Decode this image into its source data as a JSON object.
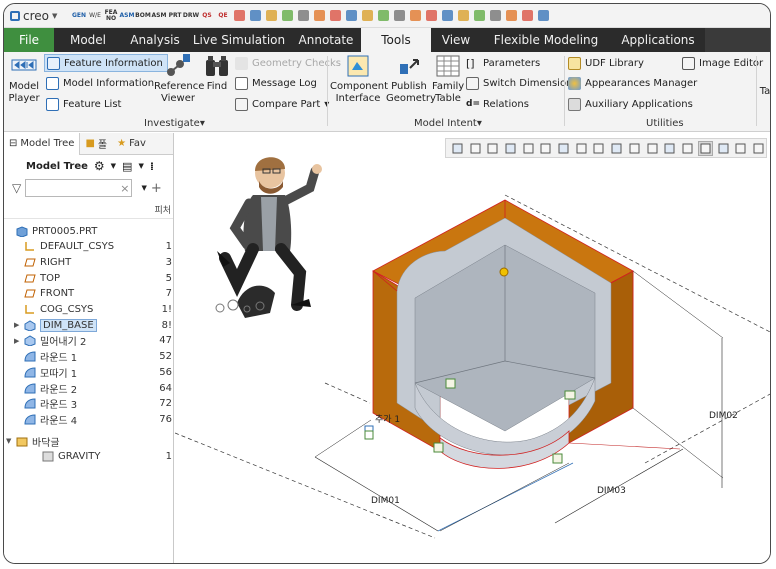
{
  "app": {
    "logo_text": "creo",
    "logo_drop": "▼"
  },
  "quick_access": [
    {
      "name": "gen",
      "text": "GEN",
      "cls": "gen"
    },
    {
      "name": "bre",
      "text": "W/E",
      "cls": ""
    },
    {
      "name": "fea",
      "text": "FEA NO",
      "cls": "blk"
    },
    {
      "name": "asm-green",
      "text": "ASM",
      "cls": "gen"
    },
    {
      "name": "bom",
      "text": "BOM",
      "cls": "blk"
    },
    {
      "name": "asm",
      "text": "ASM",
      "cls": "blk"
    },
    {
      "name": "prt",
      "text": "PRT",
      "cls": "blk"
    },
    {
      "name": "drw",
      "text": "DRW",
      "cls": "blk"
    },
    {
      "name": "qs",
      "text": "QS",
      "cls": "red"
    },
    {
      "name": "qe",
      "text": "QE",
      "cls": "red"
    }
  ],
  "tabs": {
    "file": "File",
    "model": "Model",
    "analysis": "Analysis",
    "live_simulation": "Live Simulation",
    "annotate": "Annotate",
    "tools": "Tools",
    "view": "View",
    "flexible_modeling": "Flexible Modeling",
    "applications": "Applications"
  },
  "ribbon": {
    "model_player": "Model Player",
    "feature_information": "Feature Information",
    "model_information": "Model Information",
    "feature_list": "Feature List",
    "reference_viewer": "Reference Viewer",
    "find": "Find",
    "geometry_checks": "Geometry Checks",
    "message_log": "Message Log",
    "compare_part": "Compare Part",
    "investigate": "Investigate",
    "component_interface": "Component Interface",
    "publish_geometry": "Publish Geometry",
    "family_table": "Family Table",
    "parameters": "Parameters",
    "switch_dimensions": "Switch Dimensions",
    "relations": "Relations",
    "model_intent": "Model Intent",
    "udf_library": "UDF Library",
    "appearances_manager": "Appearances Manager",
    "auxiliary_applications": "Auxiliary Applications",
    "image_editor": "Image Editor",
    "utilities": "Utilities",
    "group_arrow": "▾",
    "cut_label": "Ta"
  },
  "panel": {
    "tab_model_tree": "Model Tree",
    "tab_folder": "폴",
    "tab_fav": "Fav",
    "model_tree_title": "Model Tree",
    "search_placeholder": "",
    "clear": "×",
    "col_header": "피처"
  },
  "tree": [
    {
      "name": "part-root",
      "label": "PRT0005.PRT",
      "num": "",
      "icon": "part",
      "exp": "",
      "selected": false
    },
    {
      "name": "default-csys",
      "label": "DEFAULT_CSYS",
      "num": "1",
      "icon": "csys",
      "exp": "",
      "selected": false
    },
    {
      "name": "right-plane",
      "label": "RIGHT",
      "num": "3",
      "icon": "plane",
      "exp": "",
      "selected": false
    },
    {
      "name": "top-plane",
      "label": "TOP",
      "num": "5",
      "icon": "plane",
      "exp": "",
      "selected": false
    },
    {
      "name": "front-plane",
      "label": "FRONT",
      "num": "7",
      "icon": "plane",
      "exp": "",
      "selected": false
    },
    {
      "name": "cog-csys",
      "label": "COG_CSYS",
      "num": "1!",
      "icon": "csys",
      "exp": "",
      "selected": false
    },
    {
      "name": "dim-base",
      "label": "DIM_BASE",
      "num": "8!",
      "icon": "extrude",
      "exp": "▶",
      "selected": true
    },
    {
      "name": "extrude-2",
      "label": "밀어내기 2",
      "num": "47",
      "icon": "extrude",
      "exp": "▶",
      "selected": false
    },
    {
      "name": "round-1",
      "label": "라운드 1",
      "num": "52",
      "icon": "round",
      "exp": "",
      "selected": false
    },
    {
      "name": "draft-1",
      "label": "모따기 1",
      "num": "56",
      "icon": "round",
      "exp": "",
      "selected": false
    },
    {
      "name": "round-2",
      "label": "라운드 2",
      "num": "64",
      "icon": "round",
      "exp": "",
      "selected": false
    },
    {
      "name": "round-3",
      "label": "라운드 3",
      "num": "72",
      "icon": "round",
      "exp": "",
      "selected": false
    },
    {
      "name": "round-4",
      "label": "라운드 4",
      "num": "76",
      "icon": "round",
      "exp": "",
      "selected": false
    },
    {
      "name": "floor-group",
      "label": "바닥글",
      "num": "",
      "icon": "group",
      "exp": "▼",
      "selected": false
    },
    {
      "name": "gravity",
      "label": "GRAVITY",
      "num": "1",
      "icon": "gravity",
      "exp": "",
      "selected": false
    }
  ],
  "graphics": {
    "dim1": "DIM01",
    "dim2": "DIM02",
    "dim3": "DIM03",
    "feature_tag": "추가 1"
  },
  "colors": {
    "accent_file": "#3f8f3f",
    "ribbon_bar": "#2b2b2b",
    "selection": "#cfe3f7",
    "part_orange": "#c9760f",
    "part_gray": "#b9bfc7"
  }
}
